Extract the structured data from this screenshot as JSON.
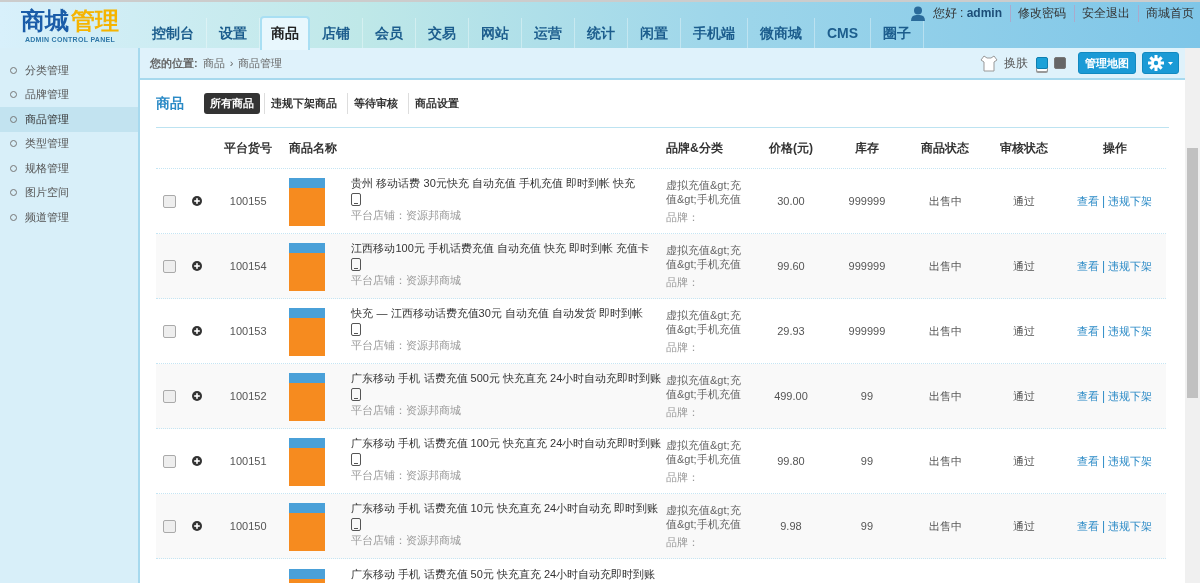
{
  "logo": {
    "title": "商城",
    "accent": "管理",
    "subtitle": "ADMIN CONTROL PANEL"
  },
  "user_bar": {
    "greeting": "您好 : **admin**",
    "links": [
      "修改密码",
      "安全退出",
      "商城首页"
    ]
  },
  "nav_tabs": [
    {
      "label": "控制台",
      "selected": false
    },
    {
      "label": "设置",
      "selected": false
    },
    {
      "label": "商品",
      "selected": true
    },
    {
      "label": "店铺",
      "selected": false
    },
    {
      "label": "会员",
      "selected": false
    },
    {
      "label": "交易",
      "selected": false
    },
    {
      "label": "网站",
      "selected": false
    },
    {
      "label": "运营",
      "selected": false
    },
    {
      "label": "统计",
      "selected": false
    },
    {
      "label": "闲置",
      "selected": false
    },
    {
      "label": "手机端",
      "selected": false
    },
    {
      "label": "微商城",
      "selected": false
    },
    {
      "label": "CMS",
      "selected": false
    },
    {
      "label": "圈子",
      "selected": false
    }
  ],
  "breadcrumb": {
    "label": "您的位置:",
    "items": [
      "商品",
      "商品管理"
    ],
    "separator": "›"
  },
  "toolbar": {
    "skin_label": "换肤",
    "skins": [
      {
        "color": "#1ba1d8",
        "selected": true
      },
      {
        "color": "#666666",
        "selected": false
      }
    ],
    "map_button": "管理地图"
  },
  "sidebar": {
    "items": [
      {
        "label": "分类管理",
        "selected": false
      },
      {
        "label": "品牌管理",
        "selected": false
      },
      {
        "label": "商品管理",
        "selected": true
      },
      {
        "label": "类型管理",
        "selected": false
      },
      {
        "label": "规格管理",
        "selected": false
      },
      {
        "label": "图片空间",
        "selected": false
      },
      {
        "label": "频道管理",
        "selected": false
      }
    ]
  },
  "section": {
    "title": "商品",
    "tabs": [
      {
        "label": "所有商品",
        "selected": true
      },
      {
        "label": "违规下架商品",
        "selected": false
      },
      {
        "label": "等待审核",
        "selected": false
      },
      {
        "label": "商品设置",
        "selected": false
      }
    ]
  },
  "table": {
    "columns": [
      "平台货号",
      "商品名称",
      "品牌&分类",
      "价格(元)",
      "库存",
      "商品状态",
      "审核状态",
      "操作"
    ],
    "action_separator": "|",
    "rows": [
      {
        "kind": "full",
        "checked": false,
        "expanded": false,
        "id": "100155",
        "name": "贵州 移动话费 30元快充 自动充值 手机充值 即时到帐 快充",
        "store": "平台店铺：资源邦商城",
        "category": "虚拟充值&gt;充值&gt;手机充值",
        "brand": "品牌：",
        "price": "30.00",
        "stock": "999999",
        "status": "出售中",
        "audit": "通过",
        "actions": [
          "查看",
          "违规下架"
        ]
      },
      {
        "kind": "full",
        "checked": false,
        "expanded": false,
        "id": "100154",
        "name": "江西移动100元 手机话费充值 自动充值 快充 即时到帐 充值卡",
        "store": "平台店铺：资源邦商城",
        "category": "虚拟充值&gt;充值&gt;手机充值",
        "brand": "品牌：",
        "price": "99.60",
        "stock": "999999",
        "status": "出售中",
        "audit": "通过",
        "actions": [
          "查看",
          "违规下架"
        ]
      },
      {
        "kind": "full",
        "checked": false,
        "expanded": false,
        "id": "100153",
        "name": "快充 — 江西移动话费充值30元 自动充值 自动发货 即时到帐",
        "store": "平台店铺：资源邦商城",
        "category": "虚拟充值&gt;充值&gt;手机充值",
        "brand": "品牌：",
        "price": "29.93",
        "stock": "999999",
        "status": "出售中",
        "audit": "通过",
        "actions": [
          "查看",
          "违规下架"
        ]
      },
      {
        "kind": "full",
        "checked": false,
        "expanded": false,
        "id": "100152",
        "name": "广东移动 手机 话费充值 500元 快充直充 24小时自动充即时到账",
        "store": "平台店铺：资源邦商城",
        "category": "虚拟充值&gt;充值&gt;手机充值",
        "brand": "品牌：",
        "price": "499.00",
        "stock": "99",
        "status": "出售中",
        "audit": "通过",
        "actions": [
          "查看",
          "违规下架"
        ]
      },
      {
        "kind": "full",
        "checked": false,
        "expanded": false,
        "id": "100151",
        "name": "广东移动 手机 话费充值 100元 快充直充 24小时自动充即时到账",
        "store": "平台店铺：资源邦商城",
        "category": "虚拟充值&gt;充值&gt;手机充值",
        "brand": "品牌：",
        "price": "99.80",
        "stock": "99",
        "status": "出售中",
        "audit": "通过",
        "actions": [
          "查看",
          "违规下架"
        ]
      },
      {
        "kind": "full",
        "checked": false,
        "expanded": false,
        "id": "100150",
        "name": "广东移动 手机 话费充值 10元 快充直充 24小时自动充 即时到账",
        "store": "平台店铺：资源邦商城",
        "category": "虚拟充值&gt;充值&gt;手机充值",
        "brand": "品牌：",
        "price": "9.98",
        "stock": "99",
        "status": "出售中",
        "audit": "通过",
        "actions": [
          "查看",
          "违规下架"
        ]
      },
      {
        "kind": "partial",
        "name": "广东移动 手机 话费充值 50元 快充直充 24小时自动充即时到账"
      }
    ]
  }
}
